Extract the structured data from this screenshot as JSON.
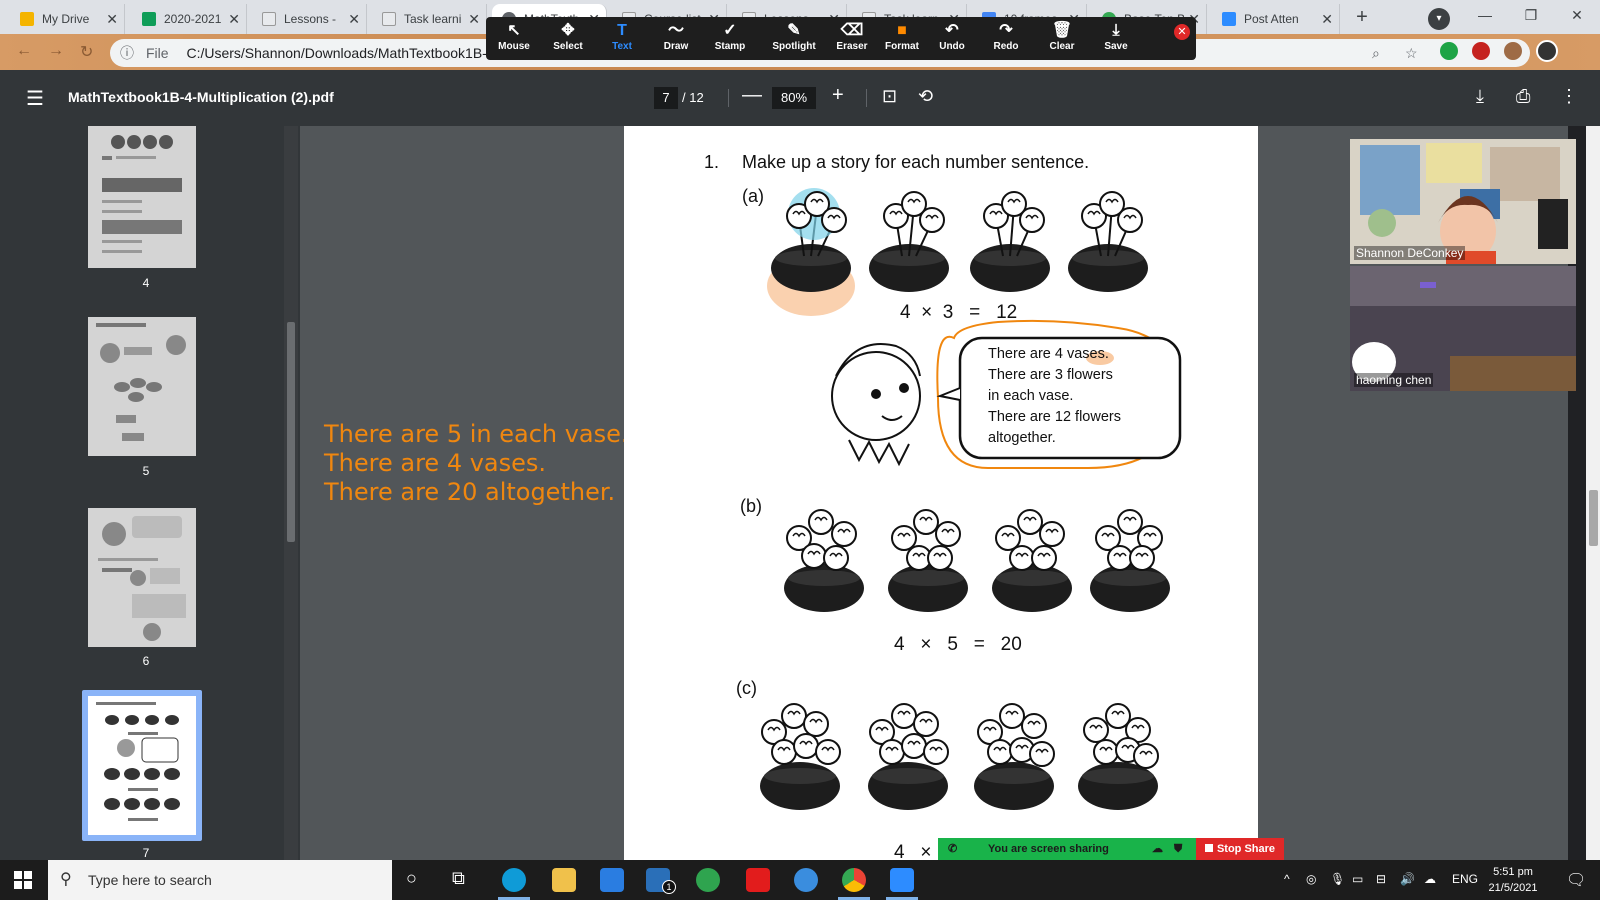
{
  "browser": {
    "tabs": [
      {
        "label": "My Drive",
        "color": "#f4b400"
      },
      {
        "label": "2020-2021",
        "color": "#0f9d58"
      },
      {
        "label": "Lessons - ",
        "color": "#e8eaed"
      },
      {
        "label": "Task learni",
        "color": "#e8eaed"
      },
      {
        "label": "MathTextb",
        "color": "#5f6368"
      },
      {
        "label": "Course list",
        "color": "#e8eaed"
      },
      {
        "label": "Lessons",
        "color": "#e8eaed"
      },
      {
        "label": "Task learn",
        "color": "#e8eaed"
      },
      {
        "label": "10 frames",
        "color": "#4285f4"
      },
      {
        "label": "Base Ten B",
        "color": "#34a853"
      },
      {
        "label": "Post Atten",
        "color": "#2d8cff"
      }
    ],
    "tab_close": "✕",
    "new_tab": "+",
    "window_controls": [
      "—",
      "❐",
      "✕"
    ],
    "address": {
      "scheme": "File",
      "path": "C:/Users/Shannon/Downloads/MathTextbook1B-4"
    }
  },
  "annotation_toolbar": {
    "tools": [
      {
        "label": "Mouse",
        "icon": "↖"
      },
      {
        "label": "Select",
        "icon": "✥"
      },
      {
        "label": "Text",
        "icon": "T",
        "selected": true
      },
      {
        "label": "Draw",
        "icon": "〜"
      },
      {
        "label": "Stamp",
        "icon": "✓"
      },
      {
        "label": "Spotlight",
        "icon": "✎"
      },
      {
        "label": "Eraser",
        "icon": "⌫"
      },
      {
        "label": "Format",
        "icon": "■"
      },
      {
        "label": "Undo",
        "icon": "↶"
      },
      {
        "label": "Redo",
        "icon": "↷"
      },
      {
        "label": "Clear",
        "icon": "🗑"
      },
      {
        "label": "Save",
        "icon": "⤓"
      }
    ],
    "close_icon": "✕"
  },
  "pdf_viewer": {
    "title": "MathTextbook1B-4-Multiplication (2).pdf",
    "current_page": "7",
    "total_pages": "/ 12",
    "zoom": "80%",
    "zoom_minus": "—",
    "zoom_plus": "+"
  },
  "sidebar": {
    "thumbnails": [
      {
        "page": "4"
      },
      {
        "page": "5"
      },
      {
        "page": "6"
      },
      {
        "page": "7",
        "selected": true
      }
    ]
  },
  "page_content": {
    "question_number": "1.",
    "question_text": "Make up a story for each number sentence.",
    "parts": [
      {
        "label": "(a)",
        "equation": "4  ×  3   =   12"
      },
      {
        "label": "(b)",
        "equation": "4   ×   5   =   20"
      },
      {
        "label": "(c)",
        "equation": "4   ×"
      }
    ],
    "speech_bubble": [
      "There are 4 vases.",
      "There are 3 flowers",
      "in each vase.",
      "There are 12 flowers",
      "altogether."
    ]
  },
  "annotation_text": "There are 5 in each vase.\nThere are 4 vases.\nThere are 20 altogether.",
  "annotation_color": "#f0870f",
  "participants": [
    {
      "name": "Shannon DeConkey"
    },
    {
      "name": "haoming chen"
    }
  ],
  "screen_share": {
    "status": "You are screen sharing",
    "stop_button": "Stop Share"
  },
  "taskbar": {
    "search_placeholder": "Type here to search",
    "language": "ENG",
    "time": "5:51 pm",
    "date": "21/5/2021",
    "mail_badge": "1"
  }
}
